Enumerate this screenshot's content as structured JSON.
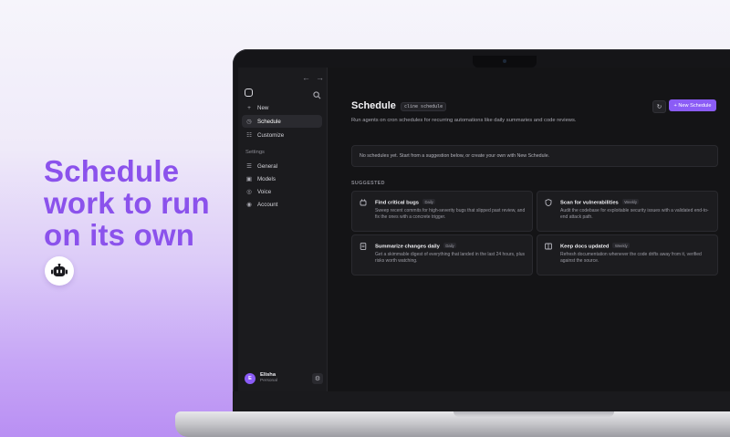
{
  "hero": {
    "lines": [
      "Schedule",
      "work to run",
      "on its own"
    ],
    "accent_color": "#8b52ec",
    "logo_icon": "robot-icon"
  },
  "sidebar": {
    "nav_back_icon": "arrow-left-icon",
    "nav_forward_icon": "arrow-right-icon",
    "items": [
      {
        "label": "New",
        "icon": "plus-icon"
      },
      {
        "label": "Schedule",
        "icon": "clock-icon",
        "active": true
      },
      {
        "label": "Customize",
        "icon": "sliders-icon"
      }
    ],
    "settings_heading": "Settings",
    "settings_items": [
      {
        "label": "General",
        "icon": "list-icon"
      },
      {
        "label": "Models",
        "icon": "cube-icon"
      },
      {
        "label": "Voice",
        "icon": "mic-icon"
      },
      {
        "label": "Account",
        "icon": "user-circle-icon"
      }
    ],
    "user": {
      "initial": "E",
      "name": "Elisha",
      "subtitle": "Personal"
    }
  },
  "main": {
    "title": "Schedule",
    "title_code": "cline schedule",
    "description": "Run agents on cron schedules for recurring automations like daily summaries and code reviews.",
    "new_button_label": "+ New Schedule",
    "empty_message": "No schedules yet. Start from a suggestion below, or create your own with New Schedule.",
    "suggested_label": "SUGGESTED",
    "suggestions": [
      {
        "title": "Find critical bugs",
        "badge": "Daily",
        "icon": "bug-icon",
        "description": "Sweep recent commits for high-severity bugs that slipped past review, and fix the ones with a concrete trigger."
      },
      {
        "title": "Scan for vulnerabilities",
        "badge": "Weekly",
        "icon": "shield-icon",
        "description": "Audit the codebase for exploitable security issues with a validated end-to-end attack path."
      },
      {
        "title": "Summarize changes daily",
        "badge": "Daily",
        "icon": "document-icon",
        "description": "Get a skimmable digest of everything that landed in the last 24 hours, plus risks worth watching."
      },
      {
        "title": "Keep docs updated",
        "badge": "Weekly",
        "icon": "book-icon",
        "description": "Refresh documentation whenever the code drifts away from it, verified against the source."
      }
    ]
  },
  "colors": {
    "accent": "#8b5cf6",
    "screen_bg": "#141416",
    "sidebar_bg": "#1b1b1e"
  }
}
